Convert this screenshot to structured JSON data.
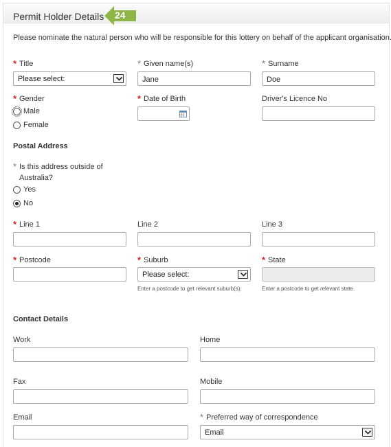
{
  "header": {
    "title": "Permit Holder Details",
    "step_badge": "24"
  },
  "intro": "Please nominate the natural person who will be responsible for this lottery on behalf of the applicant organisation.",
  "required_marker": "*",
  "personal": {
    "title": {
      "label": "Title",
      "value": "Please select:"
    },
    "given_name": {
      "label": "Given name(s)",
      "value": "Jane"
    },
    "surname": {
      "label": "Surname",
      "value": "Doe"
    },
    "gender": {
      "label": "Gender",
      "options": [
        "Male",
        "Female"
      ]
    },
    "dob": {
      "label": "Date of Birth",
      "value": ""
    },
    "licence": {
      "label": "Driver's Licence No",
      "value": ""
    }
  },
  "postal": {
    "heading": "Postal Address",
    "outside_question_line1": "Is this address outside of",
    "outside_question_line2": "Australia?",
    "outside_options": [
      "Yes",
      "No"
    ],
    "line1": {
      "label": "Line 1",
      "value": ""
    },
    "line2": {
      "label": "Line 2",
      "value": ""
    },
    "line3": {
      "label": "Line 3",
      "value": ""
    },
    "postcode": {
      "label": "Postcode",
      "value": ""
    },
    "suburb": {
      "label": "Suburb",
      "value": "Please select:",
      "hint": "Enter a postcode to get relevant suburb(s)."
    },
    "state": {
      "label": "State",
      "value": "",
      "hint": "Enter a postcode to get relevant state."
    }
  },
  "contact": {
    "heading": "Contact Details",
    "work": {
      "label": "Work",
      "value": ""
    },
    "home": {
      "label": "Home",
      "value": ""
    },
    "fax": {
      "label": "Fax",
      "value": ""
    },
    "mobile": {
      "label": "Mobile",
      "value": ""
    },
    "email": {
      "label": "Email",
      "value": ""
    },
    "preferred": {
      "label": "Preferred way of correspondence",
      "value": "Email"
    }
  },
  "colors": {
    "required": "#d9231d",
    "callout": "#8db646",
    "border": "#aaaaaa"
  }
}
